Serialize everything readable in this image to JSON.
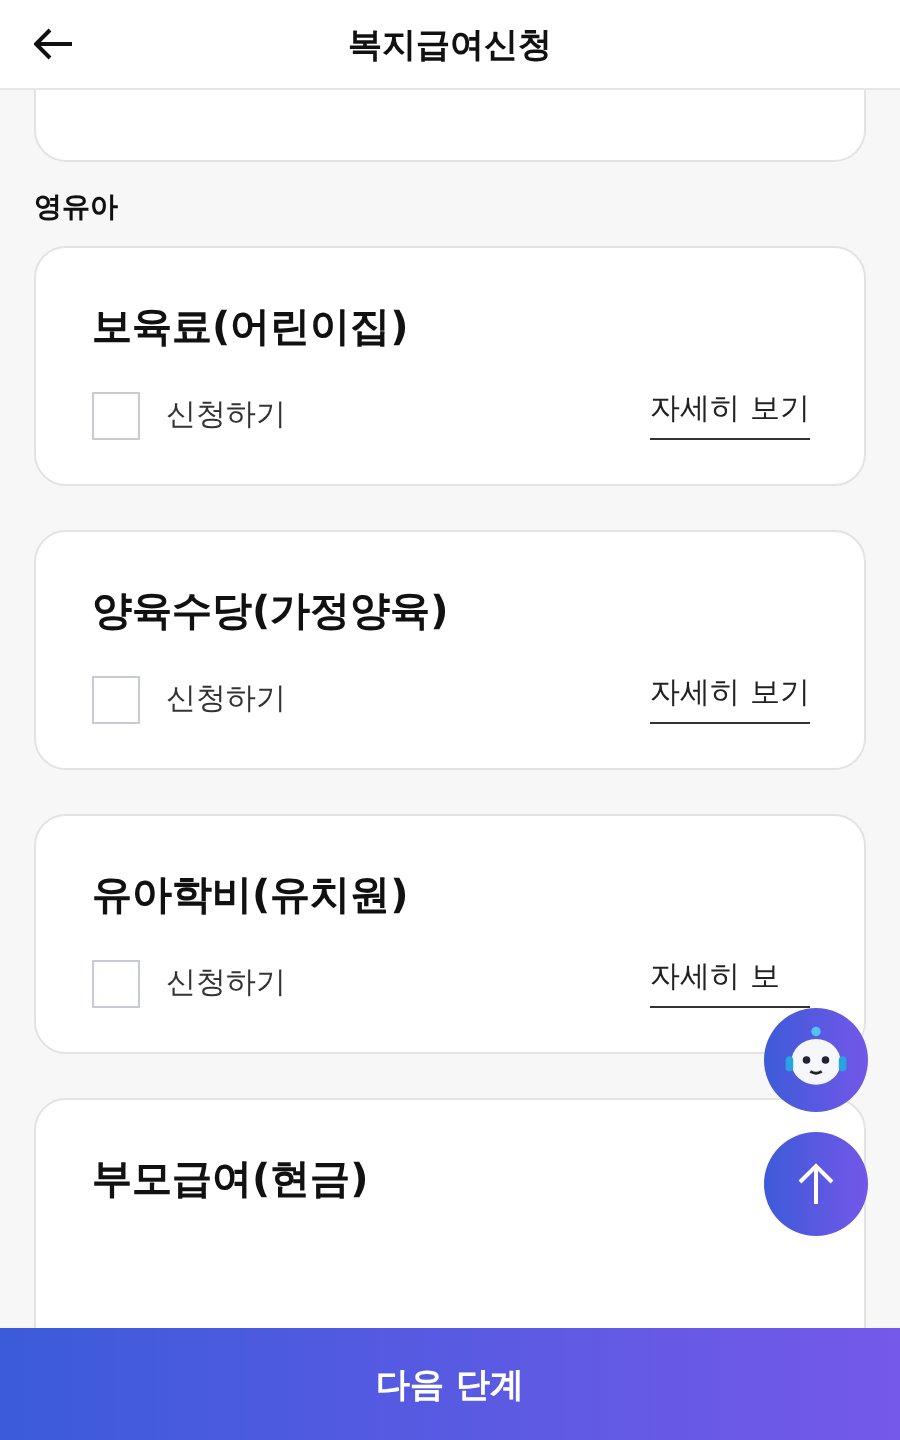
{
  "header": {
    "title": "복지급여신청"
  },
  "section": {
    "title": "영유아"
  },
  "cards": [
    {
      "title": "보육료(어린이집)",
      "checkbox_label": "신청하기",
      "checked": false,
      "link": "자세히 보기"
    },
    {
      "title": "양육수당(가정양육)",
      "checkbox_label": "신청하기",
      "checked": false,
      "link": "자세히 보기"
    },
    {
      "title": "유아학비(유치원)",
      "checkbox_label": "신청하기",
      "checked": false,
      "link": "자세히 보"
    },
    {
      "title": "부모급여(현금)"
    }
  ],
  "footer": {
    "button": "다음 단계"
  }
}
